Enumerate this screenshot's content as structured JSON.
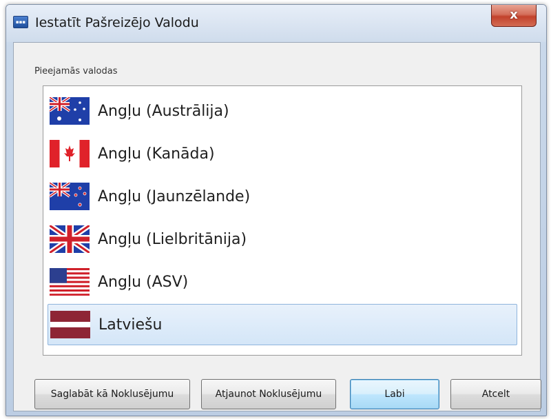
{
  "window": {
    "title": "Iestatīt Pašreizējo Valodu",
    "close_label": "x"
  },
  "group": {
    "label": "Pieejamās valodas"
  },
  "languages": [
    {
      "label": "Angļu (Austrālija)",
      "flag": "australia-flag-icon"
    },
    {
      "label": "Angļu (Kanāda)",
      "flag": "canada-flag-icon"
    },
    {
      "label": "Angļu (Jaunzēlande)",
      "flag": "new-zealand-flag-icon"
    },
    {
      "label": "Angļu (Lielbritānija)",
      "flag": "united-kingdom-flag-icon"
    },
    {
      "label": "Angļu (ASV)",
      "flag": "united-states-flag-icon"
    },
    {
      "label": "Latviešu",
      "flag": "latvia-flag-icon",
      "selected": true
    }
  ],
  "buttons": {
    "save_default": "Saglabāt kā Noklusējumu",
    "restore_default": "Atjaunot Noklusējumu",
    "ok": "Labi",
    "cancel": "Atcelt"
  },
  "colors": {
    "selection": "#d4e6f8",
    "close_button": "#c2422c",
    "default_button": "#bee6fd"
  }
}
